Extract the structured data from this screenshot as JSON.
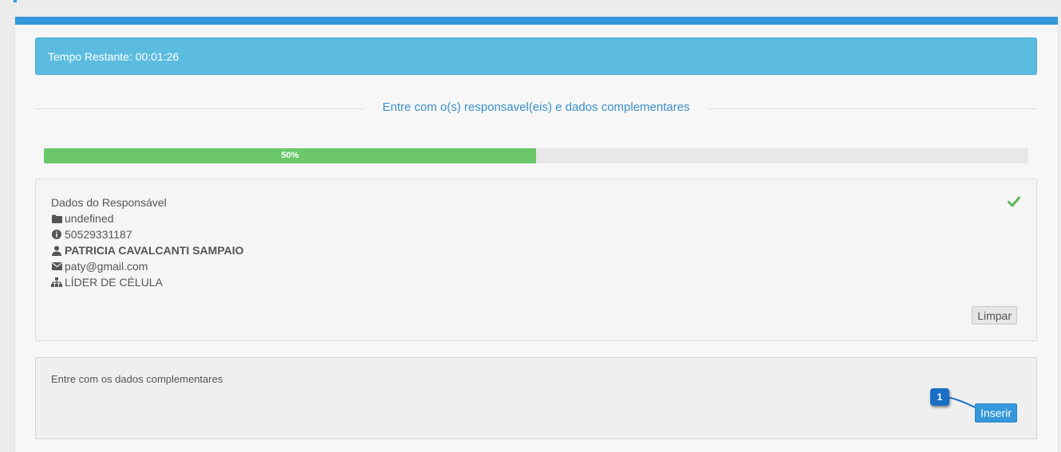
{
  "timer": {
    "text": "Tempo Restante: 00:01:26"
  },
  "section": {
    "title": "Entre com o(s) responsavel(eis) e dados complementares"
  },
  "progress": {
    "percent": 50,
    "label": "50%"
  },
  "responsavel": {
    "heading": "Dados do Responsável",
    "folder": "undefined",
    "document": "50529331187",
    "name": "PATRICIA CAVALCANTI SAMPAIO",
    "email": "paty@gmail.com",
    "role": "LÍDER DE CÉLULA",
    "clear_label": "Limpar"
  },
  "complementares": {
    "prompt": "Entre com os dados complementares",
    "insert_label": "Inserir"
  },
  "annotation": {
    "step": "1"
  },
  "colors": {
    "accent": "#3498db",
    "alert": "#5bbce0",
    "success": "#6cc76a",
    "badge": "#1a6fc4"
  }
}
